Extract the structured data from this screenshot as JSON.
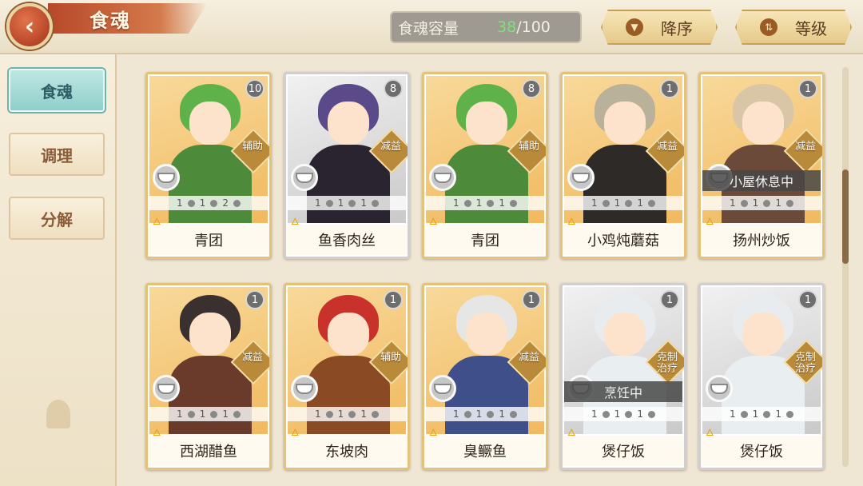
{
  "header": {
    "title": "食魂",
    "capacity_label": "食魂容量",
    "capacity_current": "38",
    "capacity_max": "/100",
    "sort_label": "降序",
    "level_label": "等级"
  },
  "sidebar": {
    "tabs": [
      {
        "label": "食魂",
        "active": true
      },
      {
        "label": "调理",
        "active": false
      },
      {
        "label": "分解",
        "active": false
      }
    ]
  },
  "cards": [
    {
      "name": "青团",
      "level": "10",
      "role": "辅助",
      "status": "",
      "stats": [
        "1",
        "1",
        "2"
      ],
      "rarity": "gold",
      "hair": "#5fb24a",
      "outfit": "#4d8a3a"
    },
    {
      "name": "鱼香肉丝",
      "level": "8",
      "role": "减益",
      "status": "",
      "stats": [
        "1",
        "1",
        "1"
      ],
      "rarity": "silver",
      "hair": "#5b4a8a",
      "outfit": "#2a2430"
    },
    {
      "name": "青团",
      "level": "8",
      "role": "辅助",
      "status": "",
      "stats": [
        "1",
        "1",
        "1"
      ],
      "rarity": "gold",
      "hair": "#5fb24a",
      "outfit": "#4d8a3a"
    },
    {
      "name": "小鸡炖蘑菇",
      "level": "1",
      "role": "减益",
      "status": "",
      "stats": [
        "1",
        "1",
        "1"
      ],
      "rarity": "gold",
      "hair": "#b9b19a",
      "outfit": "#2e2a28"
    },
    {
      "name": "扬州炒饭",
      "level": "1",
      "role": "减益",
      "status": "小屋休息中",
      "stats": [
        "1",
        "1",
        "1"
      ],
      "rarity": "gold",
      "hair": "#d8c6a6",
      "outfit": "#6b4a3a"
    },
    {
      "name": "西湖醋鱼",
      "level": "1",
      "role": "减益",
      "status": "",
      "stats": [
        "1",
        "1",
        "1"
      ],
      "rarity": "gold",
      "hair": "#3a3030",
      "outfit": "#6a3a2a"
    },
    {
      "name": "东坡肉",
      "level": "1",
      "role": "辅助",
      "status": "",
      "stats": [
        "1",
        "1",
        "1"
      ],
      "rarity": "gold",
      "hair": "#c8322a",
      "outfit": "#8a4a24"
    },
    {
      "name": "臭鳜鱼",
      "level": "1",
      "role": "减益",
      "status": "",
      "stats": [
        "1",
        "1",
        "1"
      ],
      "rarity": "gold",
      "hair": "#e6e6e6",
      "outfit": "#3f4f8a"
    },
    {
      "name": "煲仔饭",
      "level": "1",
      "role": "克制\n治疗",
      "status": "烹饪中",
      "stats": [
        "1",
        "1",
        "1"
      ],
      "rarity": "silver",
      "hair": "#e8ecef",
      "outfit": "#e9eef0"
    },
    {
      "name": "煲仔饭",
      "level": "1",
      "role": "克制\n治疗",
      "status": "",
      "stats": [
        "1",
        "1",
        "1"
      ],
      "rarity": "silver",
      "hair": "#e8ecef",
      "outfit": "#e9eef0"
    }
  ]
}
